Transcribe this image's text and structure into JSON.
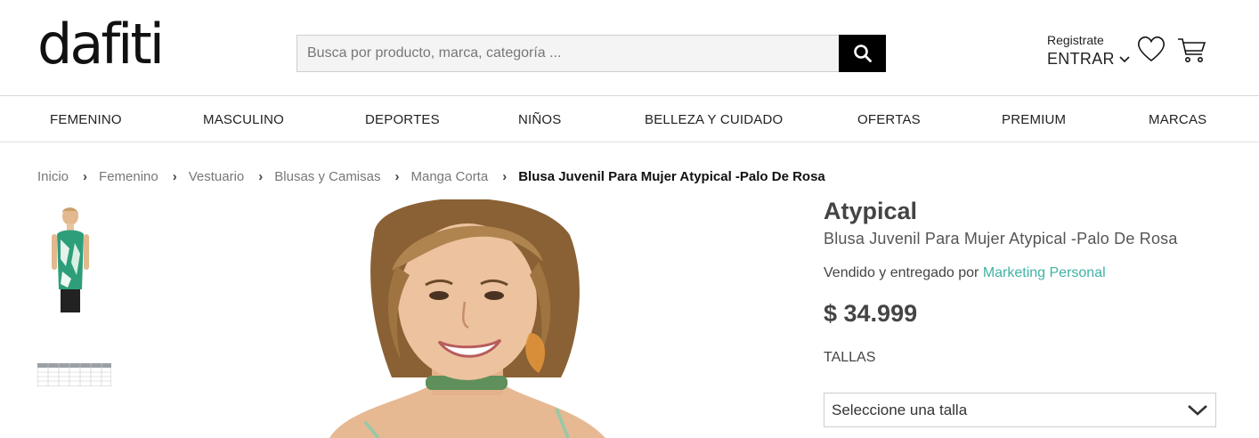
{
  "header": {
    "logo": "dafiti",
    "search_placeholder": "Busca por producto, marca, categoría ...",
    "register": "Registrate",
    "login": "ENTRAR"
  },
  "nav": [
    "FEMENINO",
    "MASCULINO",
    "DEPORTES",
    "NIÑOS",
    "BELLEZA Y CUIDADO",
    "OFERTAS",
    "PREMIUM",
    "MARCAS"
  ],
  "breadcrumb": {
    "items": [
      "Inicio",
      "Femenino",
      "Vestuario",
      "Blusas y Camisas",
      "Manga Corta"
    ],
    "current": "Blusa Juvenil Para Mujer Atypical -Palo De Rosa"
  },
  "product": {
    "brand": "Atypical",
    "name": "Blusa Juvenil Para Mujer Atypical -Palo De Rosa",
    "seller_prefix": "Vendido y entregado por",
    "seller_name": "Marketing Personal",
    "price": "$ 34.999",
    "sizes_label": "TALLAS",
    "size_select": "Seleccione una talla"
  },
  "colors": {
    "accent": "#3fb3a3",
    "search_button": "#000000",
    "text": "#444444"
  },
  "icons": {
    "search": "search-icon",
    "heart": "heart-icon",
    "cart": "cart-icon",
    "chevron": "chevron-down-icon",
    "breadcrumb_sep": "chevron-right-icon"
  }
}
